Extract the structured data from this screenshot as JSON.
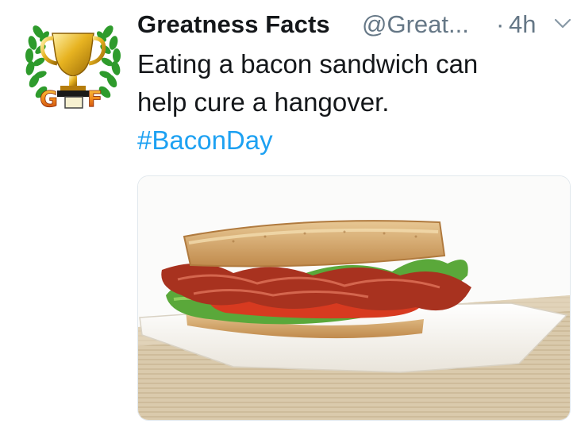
{
  "tweet": {
    "author": {
      "display_name": "Greatness Facts",
      "handle": "@Great...",
      "avatar_icon": "trophy-laurel-logo-icon",
      "avatar_text": "GF"
    },
    "separator": "·",
    "time": "4h",
    "menu_icon": "chevron-down-icon",
    "text_lines": [
      "Eating a bacon sandwich can",
      "help cure a hangover."
    ],
    "hashtag": "#BaconDay",
    "media": {
      "kind": "photo",
      "subject": "bacon-sandwich-photo"
    }
  },
  "colors": {
    "name": "#14171a",
    "secondary": "#657786",
    "link": "#1da1f2",
    "border": "#e1e8ed"
  }
}
